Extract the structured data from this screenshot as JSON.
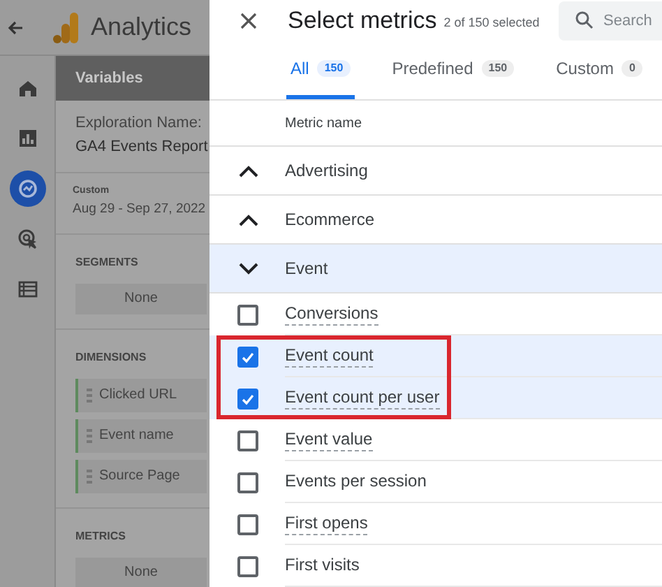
{
  "app": {
    "title": "Analytics",
    "rail": [
      {
        "selected": false
      },
      {
        "selected": false
      },
      {
        "selected": true
      },
      {
        "selected": false
      },
      {
        "selected": false
      }
    ]
  },
  "variables": {
    "header": "Variables",
    "exploration_label": "Exploration Name:",
    "exploration_name": "GA4 Events Report",
    "date_label": "Custom",
    "date_range": "Aug 29 - Sep 27, 2022",
    "sections": [
      {
        "title": "SEGMENTS",
        "kind": "empty",
        "items": [
          "None"
        ]
      },
      {
        "title": "DIMENSIONS",
        "kind": "chips",
        "items": [
          "Clicked URL",
          "Event name",
          "Source Page"
        ]
      },
      {
        "title": "METRICS",
        "kind": "empty",
        "items": [
          "None"
        ]
      }
    ]
  },
  "dialog": {
    "title": "Select metrics",
    "count": "2 of 150 selected",
    "search": {
      "placeholder": "Search"
    },
    "tabs": [
      {
        "label": "All",
        "count": "150",
        "selected": true
      },
      {
        "label": "Predefined",
        "count": "150",
        "selected": false
      },
      {
        "label": "Custom",
        "count": "0",
        "selected": false
      }
    ],
    "column": "Metric name",
    "groups": [
      {
        "label": "Advertising",
        "expanded": false
      },
      {
        "label": "Ecommerce",
        "expanded": false
      },
      {
        "label": "Event",
        "expanded": true
      }
    ],
    "metrics": [
      {
        "label": "Conversions",
        "checked": false,
        "dotted_underline": true,
        "highlighted": false
      },
      {
        "label": "Event count",
        "checked": true,
        "dotted_underline": true,
        "highlighted": true
      },
      {
        "label": "Event count per user",
        "checked": true,
        "dotted_underline": true,
        "highlighted": true
      },
      {
        "label": "Event value",
        "checked": false,
        "dotted_underline": true,
        "highlighted": false
      },
      {
        "label": "Events per session",
        "checked": false,
        "dotted_underline": false,
        "highlighted": false
      },
      {
        "label": "First opens",
        "checked": false,
        "dotted_underline": true,
        "highlighted": false
      },
      {
        "label": "First visits",
        "checked": false,
        "dotted_underline": false,
        "highlighted": false
      }
    ]
  }
}
